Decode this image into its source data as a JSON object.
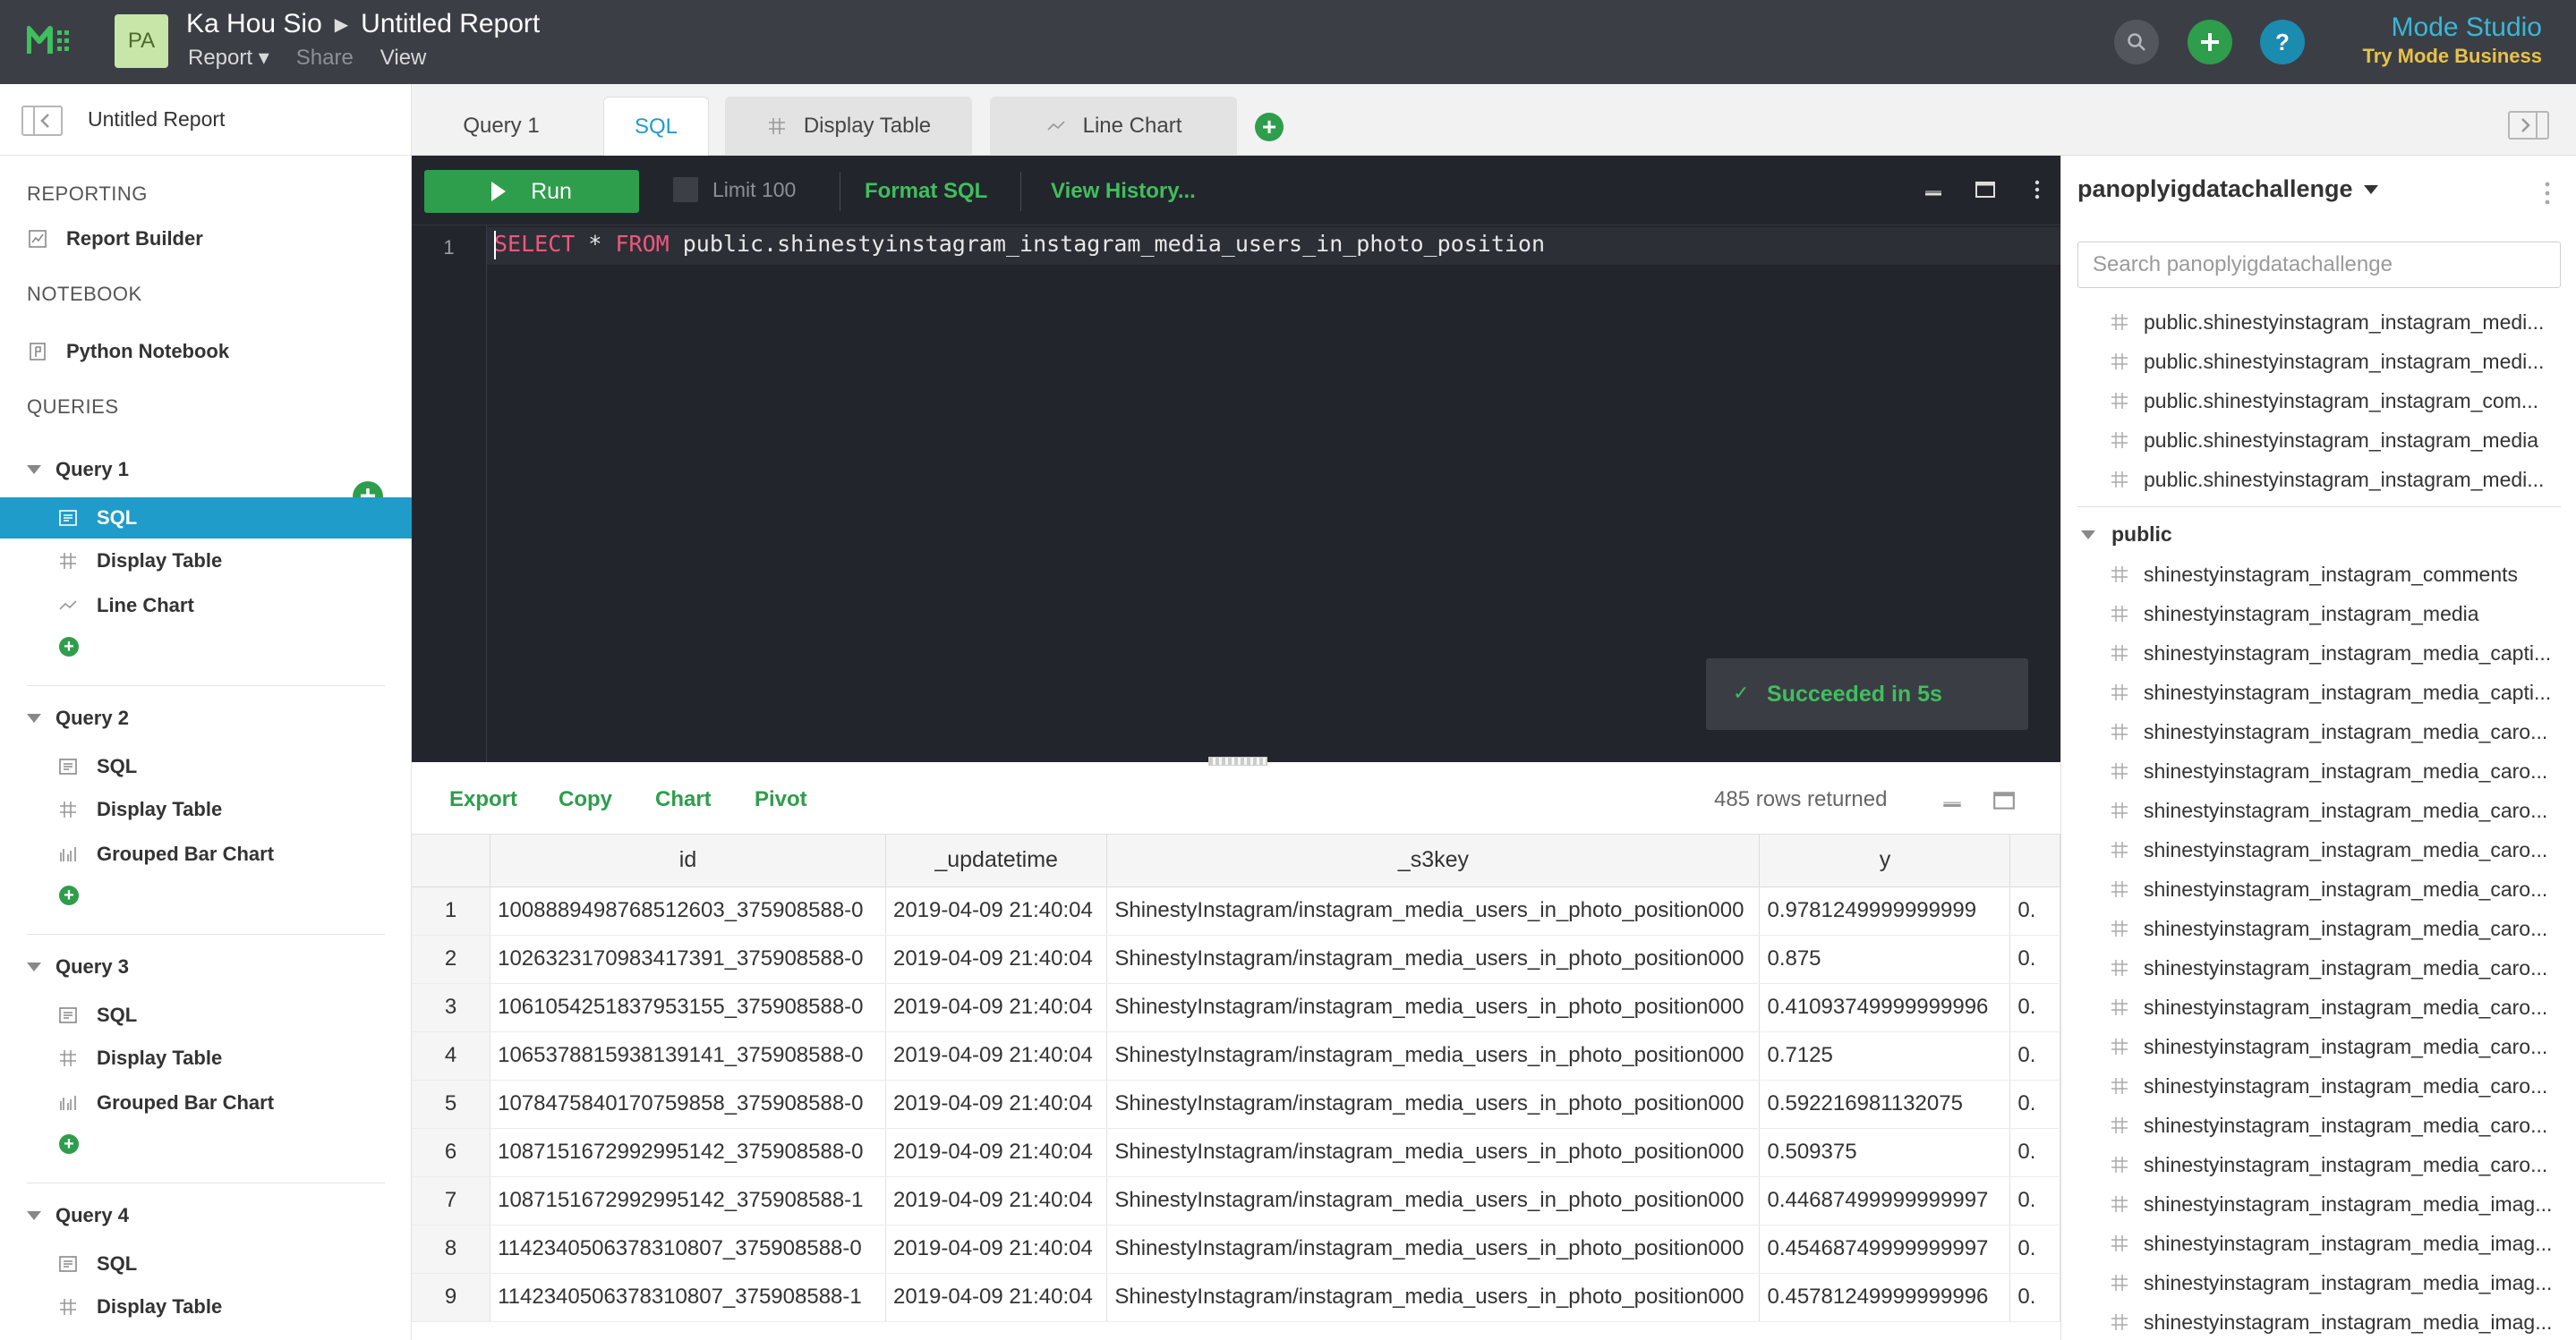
{
  "topbar": {
    "avatar": "PA",
    "user": "Ka Hou Sio",
    "report_title": "Untitled Report",
    "menu": {
      "report": "Report ▾",
      "share": "Share",
      "view": "View"
    },
    "help": "?",
    "studio_title": "Mode Studio",
    "studio_cta": "Try Mode Business"
  },
  "sidebar": {
    "title": "Untitled Report",
    "reporting_label": "REPORTING",
    "report_builder": "Report Builder",
    "notebook_label": "NOTEBOOK",
    "python_notebook": "Python Notebook",
    "queries_label": "QUERIES",
    "queries": [
      {
        "name": "Query 1",
        "items": [
          "SQL",
          "Display Table",
          "Line Chart"
        ]
      },
      {
        "name": "Query 2",
        "items": [
          "SQL",
          "Display Table",
          "Grouped Bar Chart"
        ]
      },
      {
        "name": "Query 3",
        "items": [
          "SQL",
          "Display Table",
          "Grouped Bar Chart"
        ]
      },
      {
        "name": "Query 4",
        "items": [
          "SQL",
          "Display Table"
        ]
      }
    ]
  },
  "tabs": {
    "query": "Query 1",
    "sql": "SQL",
    "display_table": "Display Table",
    "line_chart": "Line Chart"
  },
  "editor": {
    "run": "Run",
    "limit": "Limit 100",
    "format_sql": "Format SQL",
    "view_history": "View History...",
    "line_number": "1",
    "kw_select": "SELECT",
    "star": " * ",
    "kw_from": "FROM",
    "table": " public.shinestyinstagram_instagram_media_users_in_photo_position",
    "status": "Succeeded in 5s"
  },
  "results": {
    "export": "Export",
    "copy": "Copy",
    "chart": "Chart",
    "pivot": "Pivot",
    "rows_returned": "485 rows returned",
    "columns": [
      "id",
      "_updatetime",
      "_s3key",
      "y"
    ],
    "rows": [
      [
        "1",
        "1008889498768512603_375908588-0",
        "2019-04-09 21:40:04",
        "ShinestyInstagram/instagram_media_users_in_photo_position000",
        "0.9781249999999999",
        "0."
      ],
      [
        "2",
        "1026323170983417391_375908588-0",
        "2019-04-09 21:40:04",
        "ShinestyInstagram/instagram_media_users_in_photo_position000",
        "0.875",
        "0."
      ],
      [
        "3",
        "1061054251837953155_375908588-0",
        "2019-04-09 21:40:04",
        "ShinestyInstagram/instagram_media_users_in_photo_position000",
        "0.41093749999999996",
        "0."
      ],
      [
        "4",
        "1065378815938139141_375908588-0",
        "2019-04-09 21:40:04",
        "ShinestyInstagram/instagram_media_users_in_photo_position000",
        "0.7125",
        "0."
      ],
      [
        "5",
        "1078475840170759858_375908588-0",
        "2019-04-09 21:40:04",
        "ShinestyInstagram/instagram_media_users_in_photo_position000",
        "0.592216981132075",
        "0."
      ],
      [
        "6",
        "1087151672992995142_375908588-0",
        "2019-04-09 21:40:04",
        "ShinestyInstagram/instagram_media_users_in_photo_position000",
        "0.509375",
        "0."
      ],
      [
        "7",
        "1087151672992995142_375908588-1",
        "2019-04-09 21:40:04",
        "ShinestyInstagram/instagram_media_users_in_photo_position000",
        "0.44687499999999997",
        "0."
      ],
      [
        "8",
        "1142340506378310807_375908588-0",
        "2019-04-09 21:40:04",
        "ShinestyInstagram/instagram_media_users_in_photo_position000",
        "0.45468749999999997",
        "0."
      ],
      [
        "9",
        "1142340506378310807_375908588-1",
        "2019-04-09 21:40:04",
        "ShinestyInstagram/instagram_media_users_in_photo_position000",
        "0.45781249999999996",
        "0."
      ]
    ]
  },
  "schema_panel": {
    "database": "panoplyigdatachallenge",
    "search_placeholder": "Search panoplyigdatachallenge",
    "recent": [
      "public.shinestyinstagram_instagram_medi...",
      "public.shinestyinstagram_instagram_medi...",
      "public.shinestyinstagram_instagram_com...",
      "public.shinestyinstagram_instagram_media",
      "public.shinestyinstagram_instagram_medi..."
    ],
    "schema": "public",
    "tables": [
      "shinestyinstagram_instagram_comments",
      "shinestyinstagram_instagram_media",
      "shinestyinstagram_instagram_media_capti...",
      "shinestyinstagram_instagram_media_capti...",
      "shinestyinstagram_instagram_media_caro...",
      "shinestyinstagram_instagram_media_caro...",
      "shinestyinstagram_instagram_media_caro...",
      "shinestyinstagram_instagram_media_caro...",
      "shinestyinstagram_instagram_media_caro...",
      "shinestyinstagram_instagram_media_caro...",
      "shinestyinstagram_instagram_media_caro...",
      "shinestyinstagram_instagram_media_caro...",
      "shinestyinstagram_instagram_media_caro...",
      "shinestyinstagram_instagram_media_caro...",
      "shinestyinstagram_instagram_media_caro...",
      "shinestyinstagram_instagram_media_caro...",
      "shinestyinstagram_instagram_media_imag...",
      "shinestyinstagram_instagram_media_imag...",
      "shinestyinstagram_instagram_media_imag...",
      "shinestyinstagram_instagram_media_imag..."
    ]
  },
  "colors": {
    "topbar": "#3b3f45",
    "accent_green": "#2e9d4c",
    "accent_blue": "#1f9cc9",
    "editor_bg": "#23252c"
  }
}
